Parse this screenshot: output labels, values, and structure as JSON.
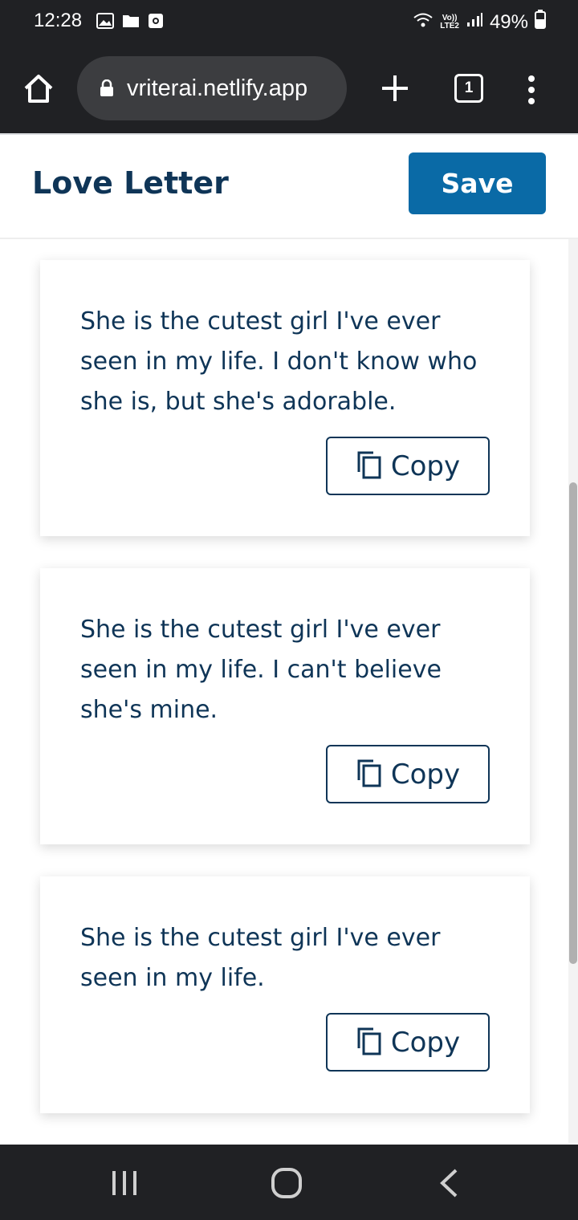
{
  "status_bar": {
    "time": "12:28",
    "battery": "49%",
    "lte_top": "Vo))",
    "lte_bottom": "LTE2",
    "left_icons": [
      "image-icon",
      "folder-icon",
      "notification-icon"
    ],
    "right_icons": [
      "wifi-icon",
      "signal-icon",
      "battery-icon"
    ]
  },
  "browser": {
    "url": "vriterai.netlify.app",
    "tab_count": "1",
    "icons": [
      "home-icon",
      "lock-icon",
      "plus-icon",
      "tabs-icon",
      "more-vert-icon"
    ]
  },
  "header": {
    "title": "Love Letter",
    "save_label": "Save"
  },
  "cards": [
    {
      "text": "She is the cutest girl I've ever seen in my life. I don't know who she is, but she's adorable.",
      "copy_label": "Copy"
    },
    {
      "text": "She is the cutest girl I've ever seen in my life. I can't believe she's mine.",
      "copy_label": "Copy"
    },
    {
      "text": "She is the cutest girl I've ever seen in my life.",
      "copy_label": "Copy"
    }
  ],
  "nav_bar": {
    "icons": [
      "recent-apps-icon",
      "home-circle-icon",
      "back-icon"
    ]
  },
  "colors": {
    "accent": "#0a6aa6",
    "text_dark": "#0f3557",
    "chrome_bg": "#202124"
  }
}
